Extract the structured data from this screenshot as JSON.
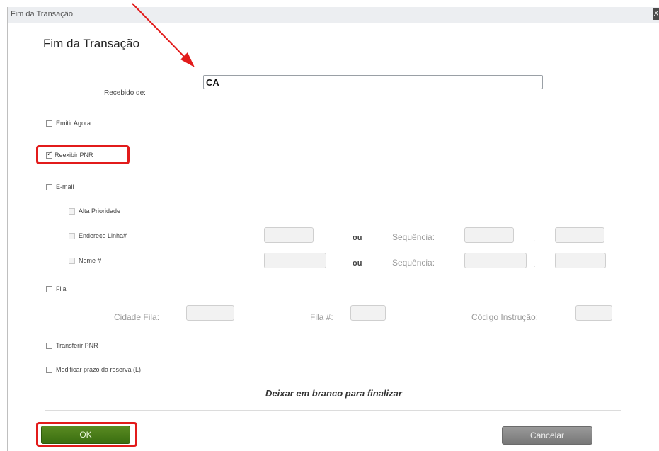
{
  "window": {
    "title": "Fim da Transação",
    "close_label": "X"
  },
  "heading": "Fim da Transação",
  "recebido": {
    "label": "Recebido de:",
    "value": "CA"
  },
  "options": {
    "emitir_agora": "Emitir Agora",
    "reexibir_pnr": "Reexibir PNR",
    "email": "E-mail",
    "alta_prioridade": "Alta Prioridade",
    "endereco": "Endereço Linha#",
    "nome": "Nome #",
    "fila": "Fila",
    "transferir_pnr": "Transferir PNR",
    "modificar_prazo": "Modificar prazo da reserva (L)"
  },
  "states": {
    "reexibir_pnr_checked": true
  },
  "fields": {
    "ou": "ou",
    "sequencia": "Sequência:",
    "dot": ".",
    "cidade_fila": "Cidade Fila:",
    "fila_num": "Fila #:",
    "codigo_instrucao": "Código Instrução:"
  },
  "note": "Deixar em branco para finalizar",
  "buttons": {
    "ok": "OK",
    "cancel": "Cancelar"
  },
  "colors": {
    "highlight": "#e21b1b",
    "ok_button": "#4a7a18",
    "cancel_button": "#888888"
  }
}
